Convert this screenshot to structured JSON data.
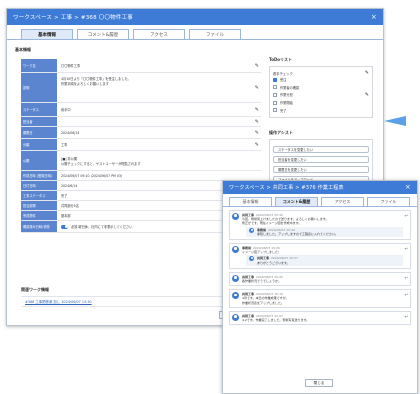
{
  "winA": {
    "title": "ワークスペース > 工事 > #368 〇〇物件工事",
    "tabs": [
      "基本情報",
      "コメント&履歴",
      "アクセス",
      "ファイル"
    ],
    "section_basic": "基本情報",
    "rows": [
      {
        "label": "ワーク名",
        "value": "〇〇物件工事"
      },
      {
        "label": "説明",
        "value": "4月10日より「〇〇物件工事」を受注しました。\n作業手順をよろしくお願いします"
      },
      {
        "label": "ステータス",
        "value": "着手中"
      },
      {
        "label": "担当者",
        "value": ""
      },
      {
        "label": "期限日",
        "value": "2024/06/14"
      },
      {
        "label": "分類",
        "value": "工事"
      },
      {
        "label": "公開",
        "value": "[■] 非公開\n公開チェックにすると、ゲストユーザーが閲覧されます"
      },
      {
        "label": "作成日時 (登録日時)",
        "value": "2024/06/07 09:10 (2024/06/07 PM 03)"
      },
      {
        "label": "日付日時",
        "value": "2024/6/14"
      },
      {
        "label": "工事ステータス",
        "value": "完了"
      },
      {
        "label": "担当部署",
        "value": "共同部分5名"
      },
      {
        "label": "完成物件",
        "value": "基本部"
      },
      {
        "label": "確認済み日時/状態",
        "value": "必須  曜日休、社内にて非表示してください"
      }
    ],
    "section_related": "関連ワーク情報",
    "related_link": "#368 工事関係案 加し 2024/06/07 13:30",
    "close_label": "閉じる",
    "todo": {
      "title": "ToDoリスト",
      "group": "着手チェック",
      "items": [
        {
          "label": "受注",
          "checked": true
        },
        {
          "label": "作業者の確認",
          "checked": false
        },
        {
          "label": "作業分担",
          "checked": false
        },
        {
          "label": "作業開始",
          "checked": false
        },
        {
          "label": "完了",
          "checked": false
        }
      ]
    },
    "assist": {
      "title": "操作アシスト",
      "buttons": [
        "ステータスを変更したい",
        "担当者を変更したい",
        "期限日を変更したい",
        "ファイルをアップロード"
      ]
    },
    "edit_icon": "pencil-icon"
  },
  "winB": {
    "title": "ワークスペース > 共同工事 > #376 作業工程表",
    "tabs": [
      "基本情報",
      "コメント&履歴",
      "アクセス",
      "ファイル"
    ],
    "comments": [
      {
        "author": "共同工事",
        "time": "2024/06/07 15:40",
        "text": "今回、現場見上げましたので送ります。よろしくお願いします。\n修正がです。現在イメージ図を作成中ます。",
        "reply": {
          "author": "事務局",
          "time": "2024/06/07 15:40",
          "text": "承知しました。アップしますので工程表に入れてください。"
        }
      },
      {
        "author": "事務局",
        "time": "2024/06/07 15:30",
        "text": "イメージ図アップしました！",
        "reply": {
          "author": "共同工事",
          "time": "2024/06/07 15:57",
          "text": "ありがとうございます。"
        }
      },
      {
        "author": "共同工事",
        "time": "2024/06/07 15:20",
        "text": "各作業状況でうでしょうか。",
        "reply": null
      },
      {
        "author": "共同工事",
        "time": "2024/06/07 15:10",
        "text": "4月です。本日の作業成果ですが、\n作業状況表をアップしました。",
        "reply": null
      },
      {
        "author": "共同工事",
        "time": "2024/06/07 15:07",
        "text": "4.2です。作業完了しました。現場写真送ります。",
        "reply": null
      }
    ],
    "close_label": "閉じる",
    "reply_icon": "reply-icon"
  },
  "colors": {
    "titlebar": "#3d7bd6",
    "label_bg": "#5b86cf",
    "arrow": "#5aa0e6"
  }
}
